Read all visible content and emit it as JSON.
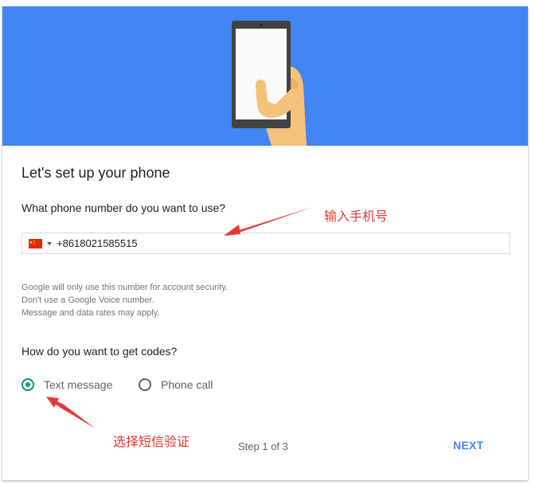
{
  "title": "Let's set up your phone",
  "phone_question": "What phone number do you want to use?",
  "phone_input": {
    "country": "CN",
    "flag_icon": "china-flag-icon",
    "value": "+8618021585515"
  },
  "help_lines": [
    "Google will only use this number for account security.",
    "Don't use a Google Voice number.",
    "Message and data rates may apply."
  ],
  "codes_question": "How do you want to get codes?",
  "options": [
    {
      "label": "Text message",
      "selected": true
    },
    {
      "label": "Phone call",
      "selected": false
    }
  ],
  "step_text": "Step 1 of 3",
  "next_label": "NEXT",
  "annotations": {
    "phone_note": "输入手机号",
    "sms_note": "选择短信验证"
  },
  "colors": {
    "hero": "#4285f4",
    "accent": "#009688",
    "next": "#4285f4",
    "annotation": "#e53935"
  }
}
